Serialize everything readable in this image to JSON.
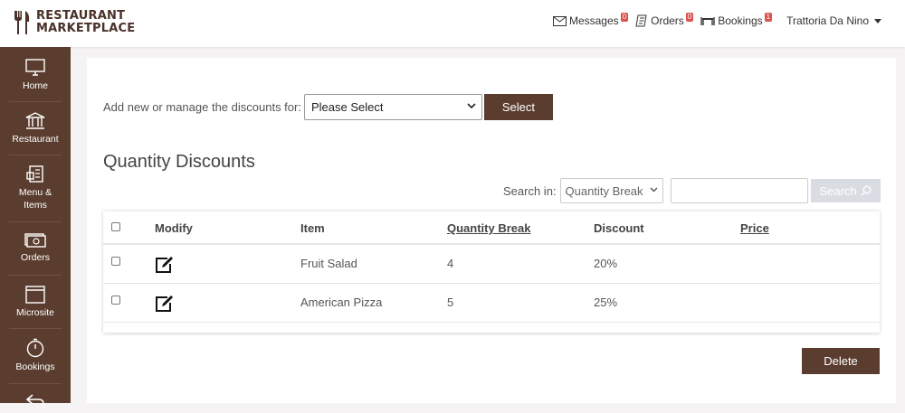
{
  "brand": {
    "line1": "RESTAURANT",
    "line2": "MARKETPLACE"
  },
  "header": {
    "messages": {
      "label": "Messages",
      "count": "0"
    },
    "orders": {
      "label": "Orders",
      "count": "0"
    },
    "bookings": {
      "label": "Bookings",
      "count": "1"
    },
    "user": "Trattoria Da Nino"
  },
  "sidebar": {
    "items": [
      {
        "label": "Home",
        "icon": "monitor-icon"
      },
      {
        "label": "Restaurant",
        "icon": "building-icon"
      },
      {
        "label": "Menu &",
        "label2": "Items",
        "icon": "menu-icon"
      },
      {
        "label": "Orders",
        "icon": "cash-icon"
      },
      {
        "label": "Microsite",
        "icon": "window-icon"
      },
      {
        "label": "Bookings",
        "icon": "stopwatch-icon"
      },
      {
        "label": "",
        "icon": "back-arrow-icon"
      }
    ]
  },
  "main": {
    "manage_label": "Add new or manage the discounts for:",
    "manage_select": "Please Select",
    "select_button": "Select",
    "title": "Quantity Discounts",
    "search_in_label": "Search in:",
    "search_in_value": "Quantity Break",
    "search_input": "",
    "search_button": "Search",
    "table": {
      "headers": [
        "Modify",
        "Item",
        "Quantity Break",
        "Discount",
        "Price"
      ],
      "rows": [
        {
          "item": "Fruit Salad",
          "quantity_break": "4",
          "discount": "20%",
          "price": ""
        },
        {
          "item": "American Pizza",
          "quantity_break": "5",
          "discount": "25%",
          "price": ""
        }
      ]
    },
    "delete_button": "Delete"
  },
  "colors": {
    "brand": "#5b3d2f",
    "badge": "#d9534f",
    "disabled_button": "#d9dde3"
  }
}
